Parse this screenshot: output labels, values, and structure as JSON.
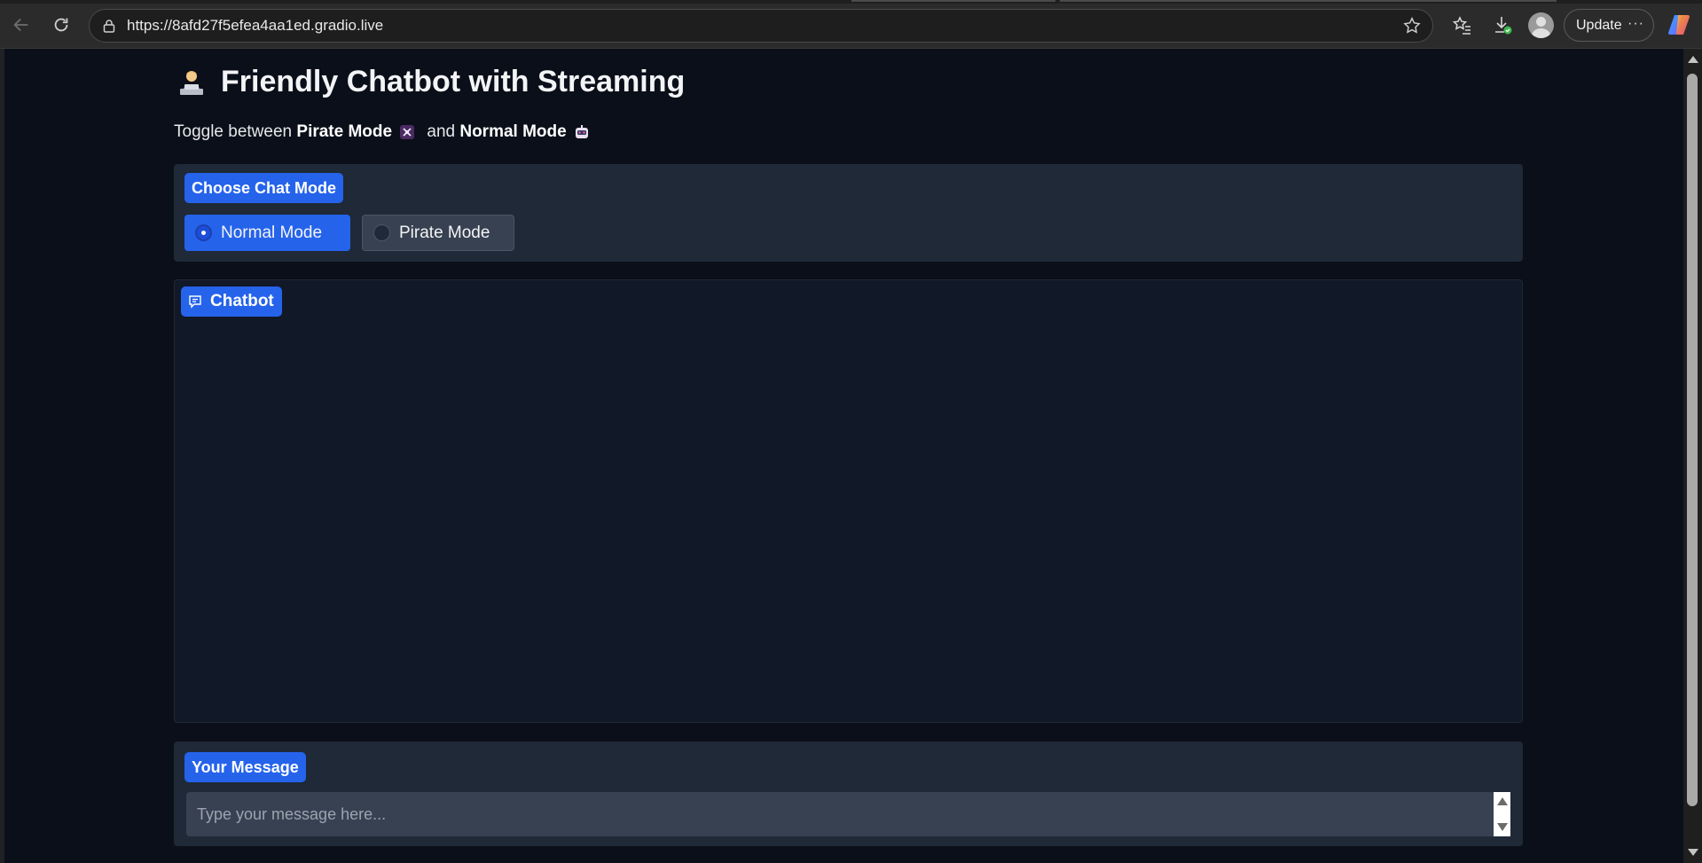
{
  "browser": {
    "url": "https://8afd27f5efea4aa1ed.gradio.live",
    "update_label": "Update",
    "more_label": "···"
  },
  "page": {
    "title": "Friendly Chatbot with Streaming",
    "title_icon": "person-technologist-emoji",
    "subtitle_prefix": "Toggle between ",
    "subtitle_pirate": "Pirate Mode",
    "subtitle_and": " and ",
    "subtitle_normal": "Normal Mode"
  },
  "mode_selector": {
    "label": "Choose Chat Mode",
    "options": [
      {
        "label": "Normal Mode",
        "selected": true
      },
      {
        "label": "Pirate Mode",
        "selected": false
      }
    ]
  },
  "chatbot": {
    "label": "Chatbot",
    "icon": "chat-bubble-icon"
  },
  "message": {
    "label": "Your Message",
    "placeholder": "Type your message here..."
  },
  "colors": {
    "accent": "#2563eb",
    "background": "#0b0f19",
    "panel": "#1f2937"
  }
}
